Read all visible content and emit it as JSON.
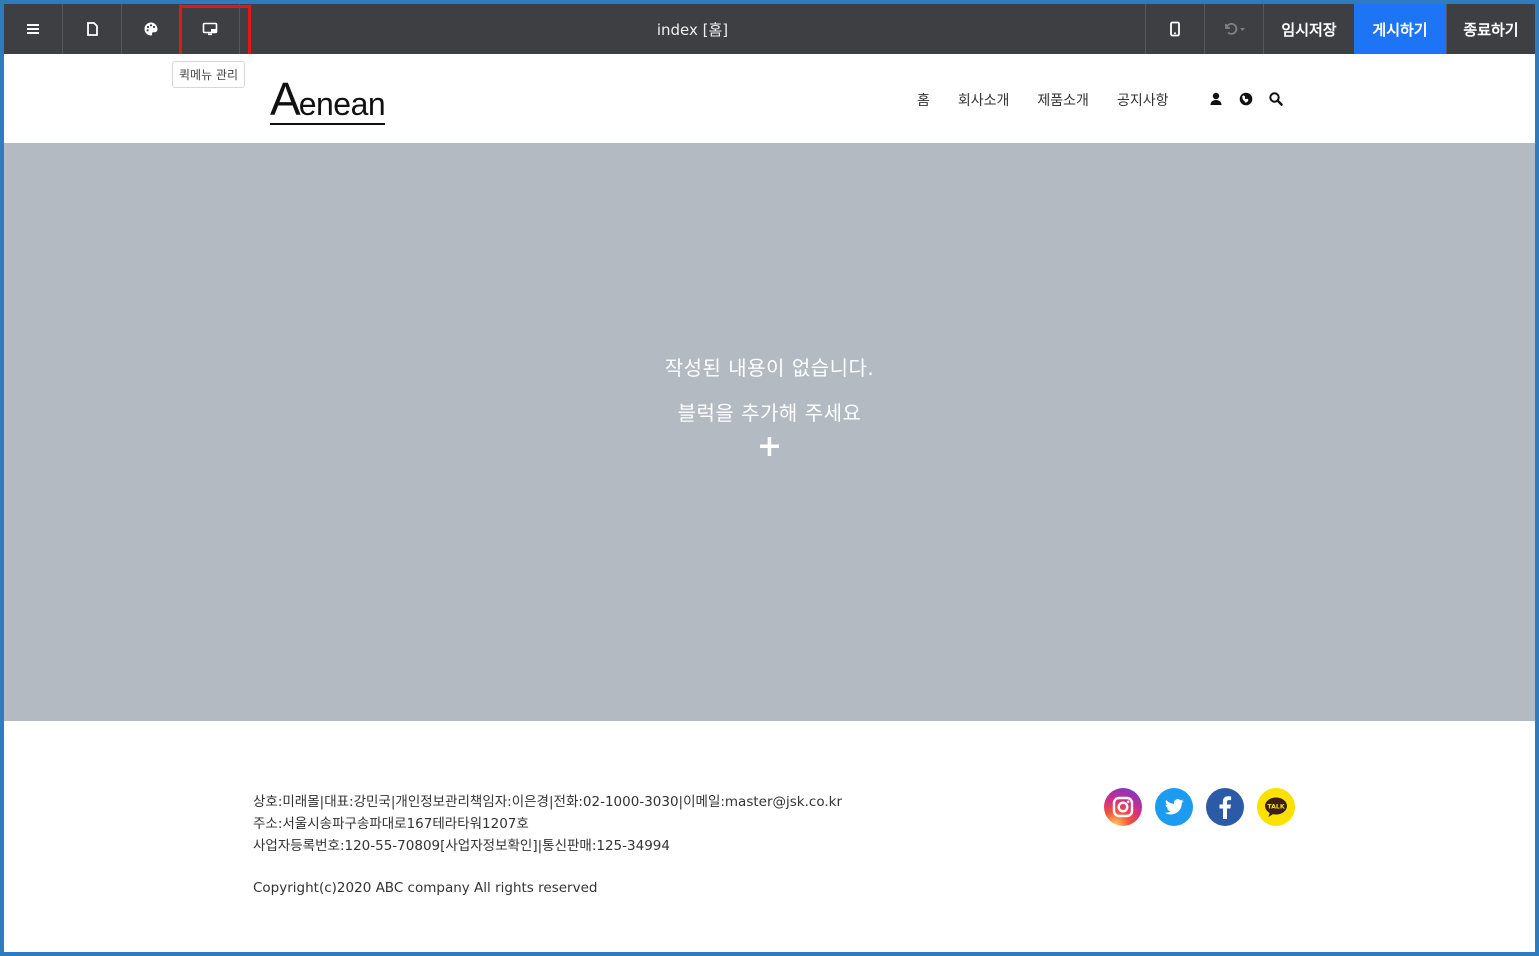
{
  "toolbar": {
    "title": "index [홈]",
    "save_label": "임시저장",
    "publish_label": "게시하기",
    "exit_label": "종료하기",
    "tooltip": "퀵메뉴 관리",
    "publish_color": "#1d74f5",
    "bg_color": "#3d3f43"
  },
  "site": {
    "logo_initial": "A",
    "logo_rest": "enean",
    "nav": [
      "홈",
      "회사소개",
      "제품소개",
      "공지사항"
    ]
  },
  "main": {
    "empty_line1": "작성된 내용이 없습니다.",
    "empty_line2": "블럭을 추가해 주세요",
    "add_symbol": "+",
    "bg_color": "#b3bac2"
  },
  "footer": {
    "line1": "상호:미래몰|대표:강민국|개인정보관리책임자:이은경|전화:02-1000-3030|이메일:master@jsk.co.kr",
    "line2": "주소:서울시송파구송파대로167테라타워1207호",
    "line3": "사업자등록번호:120-55-70809[사업자정보확인]|통신판매:125-34994",
    "copyright": "Copyright(c)2020 ABC company All rights reserved",
    "kakao_badge": "TALK"
  }
}
